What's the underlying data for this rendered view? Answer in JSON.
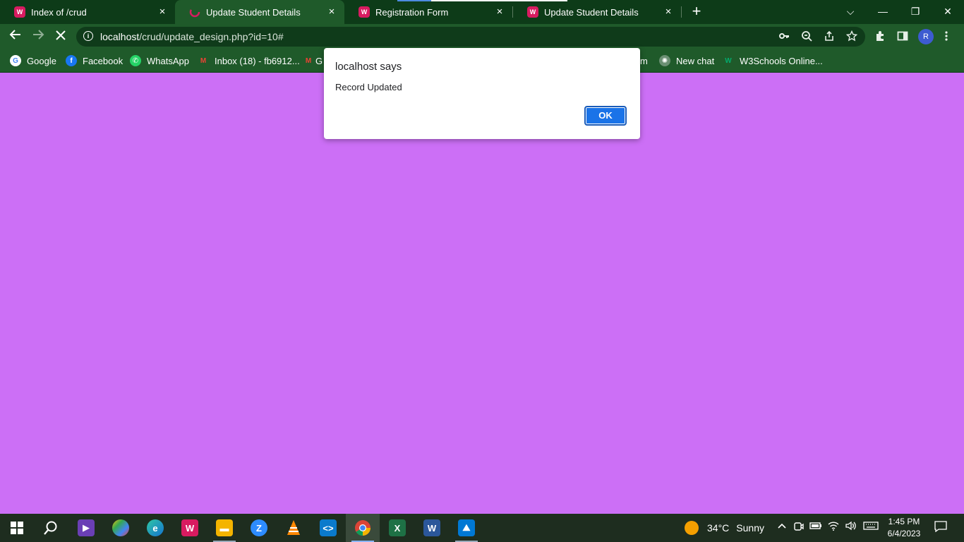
{
  "browser": {
    "tabs": [
      {
        "title": "Index of /crud",
        "close": "×"
      },
      {
        "title": "Update Student Details",
        "close": "×"
      },
      {
        "title": "Registration Form",
        "close": "×"
      },
      {
        "title": "Update Student Details",
        "close": "×"
      }
    ],
    "new_tab": "+",
    "window_controls": {
      "tab_search": "⌵",
      "minimize": "—",
      "restore": "❐",
      "close": "✕"
    },
    "url_host": "localhost",
    "url_path": "/crud/update_design.php?id=10#",
    "profile_initial": "R"
  },
  "bookmarks": [
    {
      "label": "Google",
      "icon": "google-icon",
      "color": "#ffffff"
    },
    {
      "label": "Facebook",
      "icon": "facebook-icon",
      "color": "#1877f2"
    },
    {
      "label": "WhatsApp",
      "icon": "whatsapp-icon",
      "color": "#25d366"
    },
    {
      "label": "Inbox (18) - fb6912...",
      "icon": "gmail-icon",
      "color": "#ea4335"
    },
    {
      "label": "G",
      "icon": "gmail-icon",
      "color": "#ea4335"
    },
    {
      "label": "m",
      "icon": "",
      "color": ""
    },
    {
      "label": "New chat",
      "icon": "chatgpt-icon",
      "color": "#74aa9c"
    },
    {
      "label": "W3Schools Online...",
      "icon": "w3schools-icon",
      "color": "#04aa6d"
    }
  ],
  "dialog": {
    "title": "localhost says",
    "message": "Record Updated",
    "ok_label": "OK"
  },
  "page": {
    "background": "#cc6ff6"
  },
  "taskbar": {
    "apps": [
      "start-icon",
      "search-icon",
      "visual-studio-icon",
      "paint-icon",
      "edge-icon",
      "wamp-icon",
      "file-explorer-icon",
      "zoom-icon",
      "vlc-icon",
      "vscode-icon",
      "chrome-icon",
      "excel-icon",
      "word-icon",
      "photos-icon"
    ],
    "weather": {
      "temp": "34°C",
      "condition": "Sunny"
    },
    "time": "1:45 PM",
    "date": "6/4/2023"
  }
}
